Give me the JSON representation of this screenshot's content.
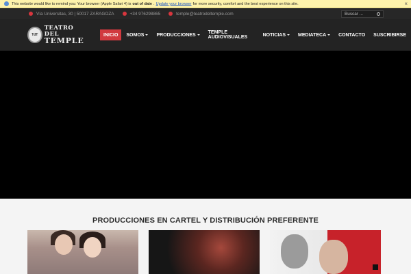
{
  "banner": {
    "text_before": "This website would like to remind you: Your browser (Apple Safari 4) is",
    "bold": "out of date",
    "text_mid": ".",
    "link": "Update your browser",
    "text_after": "for more security, comfort and the best experience on this site.",
    "close": "×",
    "icon": "browser-icon"
  },
  "topbar": {
    "address": "Vía Universitas, 30 | 50017 ZARAGOZA",
    "phone": "+34 976298865",
    "email": "temple@teatrodeltemple.com",
    "search_placeholder": "Buscar ..."
  },
  "logo": {
    "line1": "TEATRO DEL",
    "line2": "TEMPLE",
    "crest": "TdT"
  },
  "nav": {
    "items": [
      {
        "label": "INICIO",
        "active": true,
        "dropdown": false
      },
      {
        "label": "SOMOS",
        "active": false,
        "dropdown": true
      },
      {
        "label": "PRODUCCIONES",
        "active": false,
        "dropdown": true
      },
      {
        "label": "TEMPLE AUDIOVISUALES",
        "active": false,
        "dropdown": false
      },
      {
        "label": "NOTICIAS",
        "active": false,
        "dropdown": true
      },
      {
        "label": "MEDIATECA",
        "active": false,
        "dropdown": true
      },
      {
        "label": "CONTACTO",
        "active": false,
        "dropdown": false
      },
      {
        "label": "SUSCRIBIRSE",
        "active": false,
        "dropdown": false
      }
    ]
  },
  "section": {
    "title": "PRODUCCIONES EN CARTEL Y DISTRIBUCIÓN PREFERENTE"
  },
  "colors": {
    "accent": "#d13a3f",
    "header_bg": "#232323",
    "topbar_bg": "#272727",
    "banner_bg": "#fdf2ab"
  }
}
